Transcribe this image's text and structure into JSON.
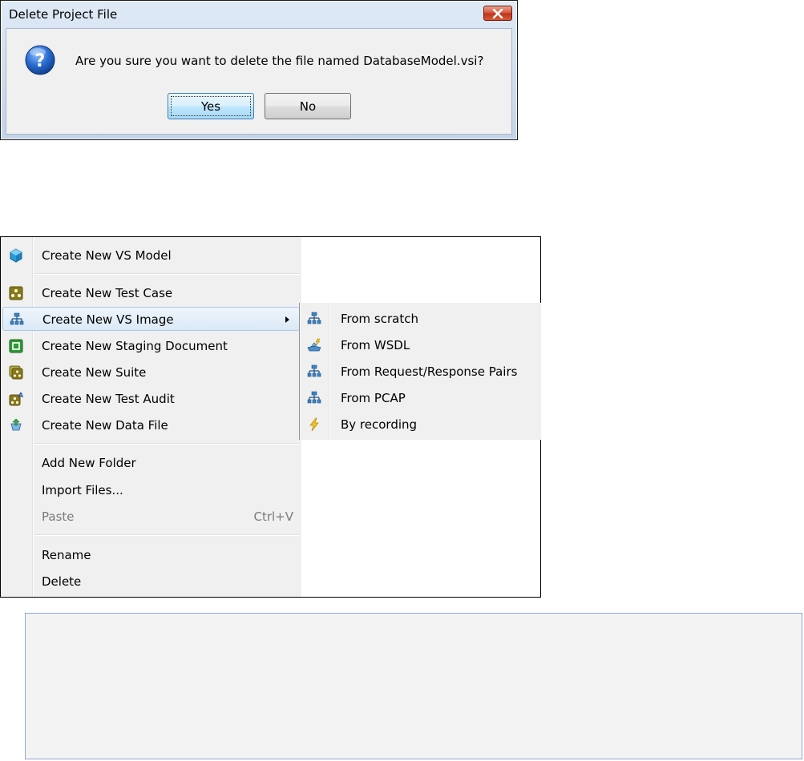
{
  "dialog": {
    "title": "Delete Project File",
    "message": "Are you sure you want to delete the file named DatabaseModel.vsi?",
    "buttons": {
      "yes": "Yes",
      "no": "No"
    },
    "icon": "question-icon",
    "close_icon": "close-icon"
  },
  "context_menu": {
    "items": [
      {
        "label": "Create New VS Model",
        "icon": "vs-model-icon"
      },
      {
        "label": "Create New Test Case",
        "icon": "test-case-icon"
      },
      {
        "label": "Create New VS Image",
        "icon": "vs-image-icon",
        "has_submenu": true,
        "highlighted": true
      },
      {
        "label": "Create New Staging Document",
        "icon": "staging-document-icon"
      },
      {
        "label": "Create New Suite",
        "icon": "suite-icon"
      },
      {
        "label": "Create New Test Audit",
        "icon": "test-audit-icon"
      },
      {
        "label": "Create New Data File",
        "icon": "data-file-icon"
      },
      {
        "label": "Add New Folder"
      },
      {
        "label": "Import Files..."
      },
      {
        "label": "Paste",
        "shortcut": "Ctrl+V",
        "disabled": true
      },
      {
        "label": "Rename"
      },
      {
        "label": "Delete"
      }
    ],
    "submenu": {
      "items": [
        {
          "label": "From scratch",
          "icon": "network-icon"
        },
        {
          "label": "From WSDL",
          "icon": "wsdl-icon"
        },
        {
          "label": "From Request/Response Pairs",
          "icon": "network-icon"
        },
        {
          "label": "From PCAP",
          "icon": "network-icon"
        },
        {
          "label": "By recording",
          "icon": "lightning-icon"
        }
      ]
    }
  },
  "colors": {
    "menu_bg": "#f0f0f0",
    "highlight_border": "#a8c8ea",
    "dialog_frame": "#c3d4e8",
    "question_blue": "#1f5fb8"
  }
}
